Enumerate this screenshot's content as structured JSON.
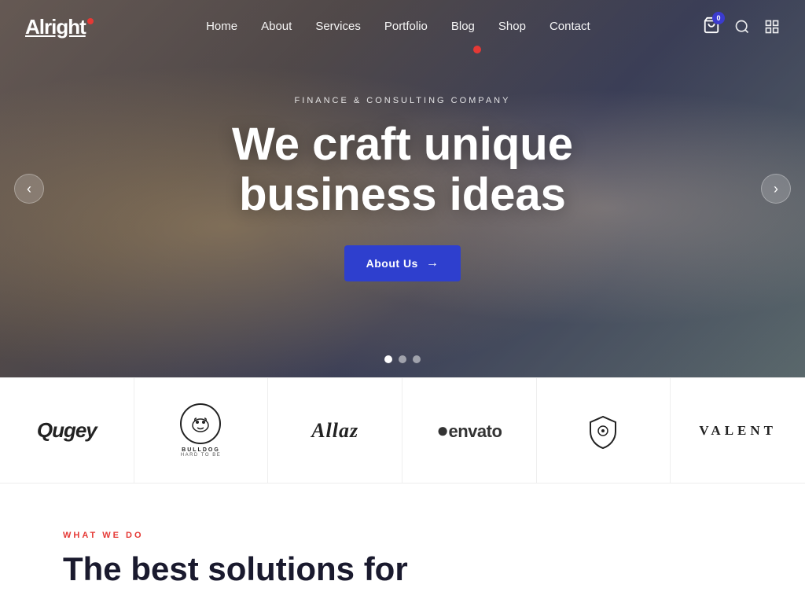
{
  "logo": {
    "text": "Alright",
    "dot": "·"
  },
  "nav": {
    "links": [
      {
        "label": "Home",
        "id": "home"
      },
      {
        "label": "About",
        "id": "about"
      },
      {
        "label": "Services",
        "id": "services"
      },
      {
        "label": "Portfolio",
        "id": "portfolio"
      },
      {
        "label": "Blog",
        "id": "blog"
      },
      {
        "label": "Shop",
        "id": "shop"
      },
      {
        "label": "Contact",
        "id": "contact"
      }
    ],
    "cart_count": "0",
    "search_label": "search",
    "grid_label": "menu-grid"
  },
  "hero": {
    "subtitle": "Finance & Consulting Company",
    "title_line1": "We craft unique",
    "title_line2": "business ideas",
    "cta_label": "About Us",
    "dots": [
      "active",
      "inactive",
      "inactive"
    ]
  },
  "logos": [
    {
      "id": "qugey",
      "text": "Qugey",
      "style": ""
    },
    {
      "id": "bulldog",
      "text": "BULLDOG",
      "subtitle": "HARD TO BE",
      "style": "bulldog"
    },
    {
      "id": "allaz",
      "text": "Allaz",
      "style": "italic"
    },
    {
      "id": "envato",
      "text": "●envato",
      "style": "envato"
    },
    {
      "id": "valent-shield",
      "text": "⊍",
      "style": "shield"
    },
    {
      "id": "valent",
      "text": "VALENT",
      "style": "serif"
    }
  ],
  "what_we_do": {
    "tag": "WHAT WE DO",
    "title_line1": "The best solutions for"
  }
}
